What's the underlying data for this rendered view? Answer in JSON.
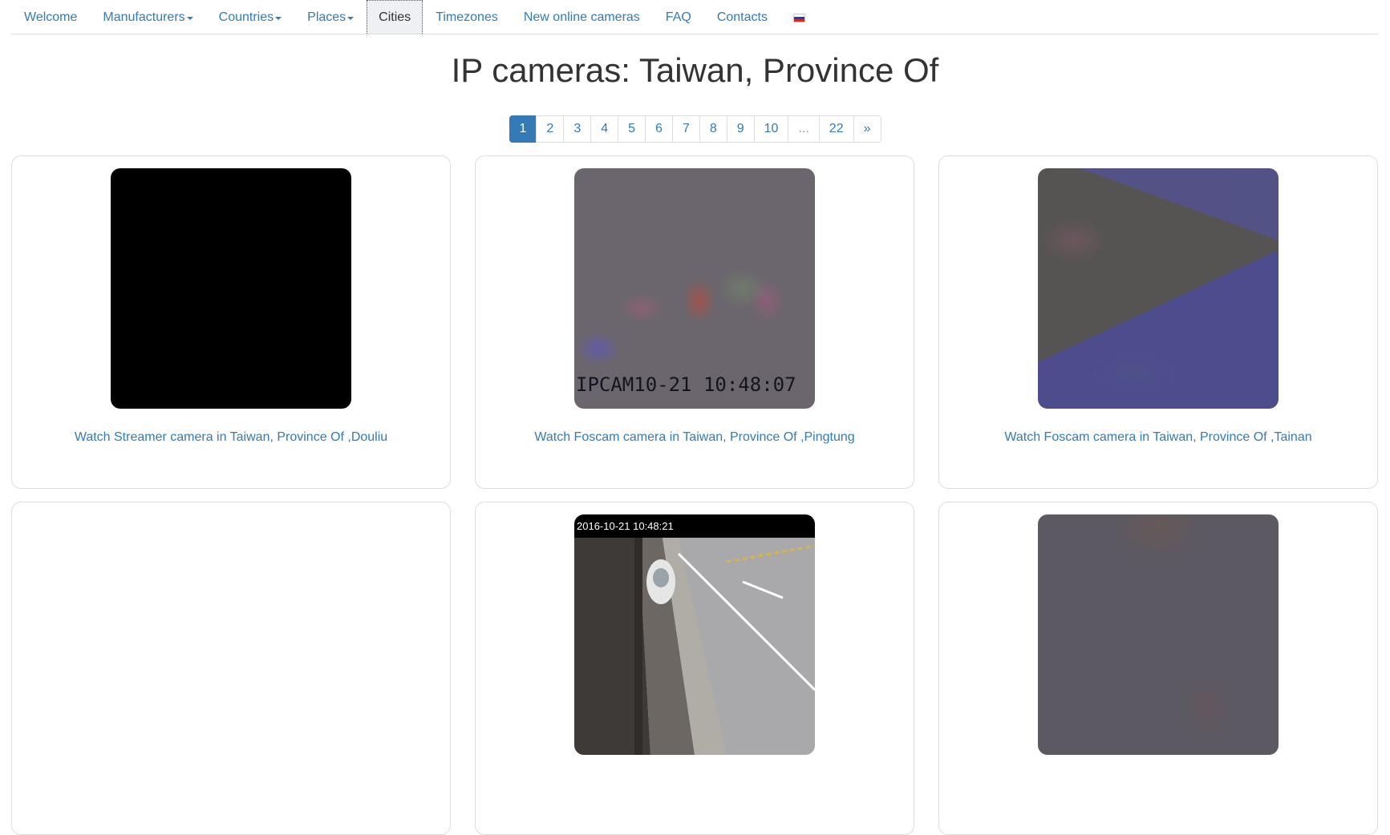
{
  "nav": {
    "items": [
      {
        "label": "Welcome",
        "dropdown": false
      },
      {
        "label": "Manufacturers",
        "dropdown": true
      },
      {
        "label": "Countries",
        "dropdown": true
      },
      {
        "label": "Places",
        "dropdown": true
      },
      {
        "label": "Cities",
        "dropdown": false,
        "active": true
      },
      {
        "label": "Timezones",
        "dropdown": false
      },
      {
        "label": "New online cameras",
        "dropdown": false
      },
      {
        "label": "FAQ",
        "dropdown": false
      },
      {
        "label": "Contacts",
        "dropdown": false
      }
    ],
    "language_flag": "russian-flag-icon"
  },
  "page": {
    "title": "IP cameras: Taiwan, Province Of"
  },
  "pagination": {
    "current": 1,
    "pages": [
      "1",
      "2",
      "3",
      "4",
      "5",
      "6",
      "7",
      "8",
      "9",
      "10",
      "...",
      "22",
      "»"
    ]
  },
  "cameras": [
    {
      "link": "Watch Streamer camera in Taiwan, Province Of ,Douliu",
      "thumbnail": "black-frame"
    },
    {
      "link": "Watch Foscam camera in Taiwan, Province Of ,Pingtung",
      "thumbnail": "noisy-night-frame",
      "overlay_text": "IPCAM10-21 10:48:07"
    },
    {
      "link": "Watch Foscam camera in Taiwan, Province Of ,Tainan",
      "thumbnail": "dark-blue-frame"
    },
    {
      "link": "",
      "thumbnail": "empty"
    },
    {
      "link": "",
      "thumbnail": "street-frame",
      "overlay_text": "2016-10-21 10:48:21"
    },
    {
      "link": "",
      "thumbnail": "dark-purple-frame"
    }
  ],
  "colors": {
    "link": "#337ab7",
    "active_page": "#337ab7",
    "border": "#dddddd"
  }
}
